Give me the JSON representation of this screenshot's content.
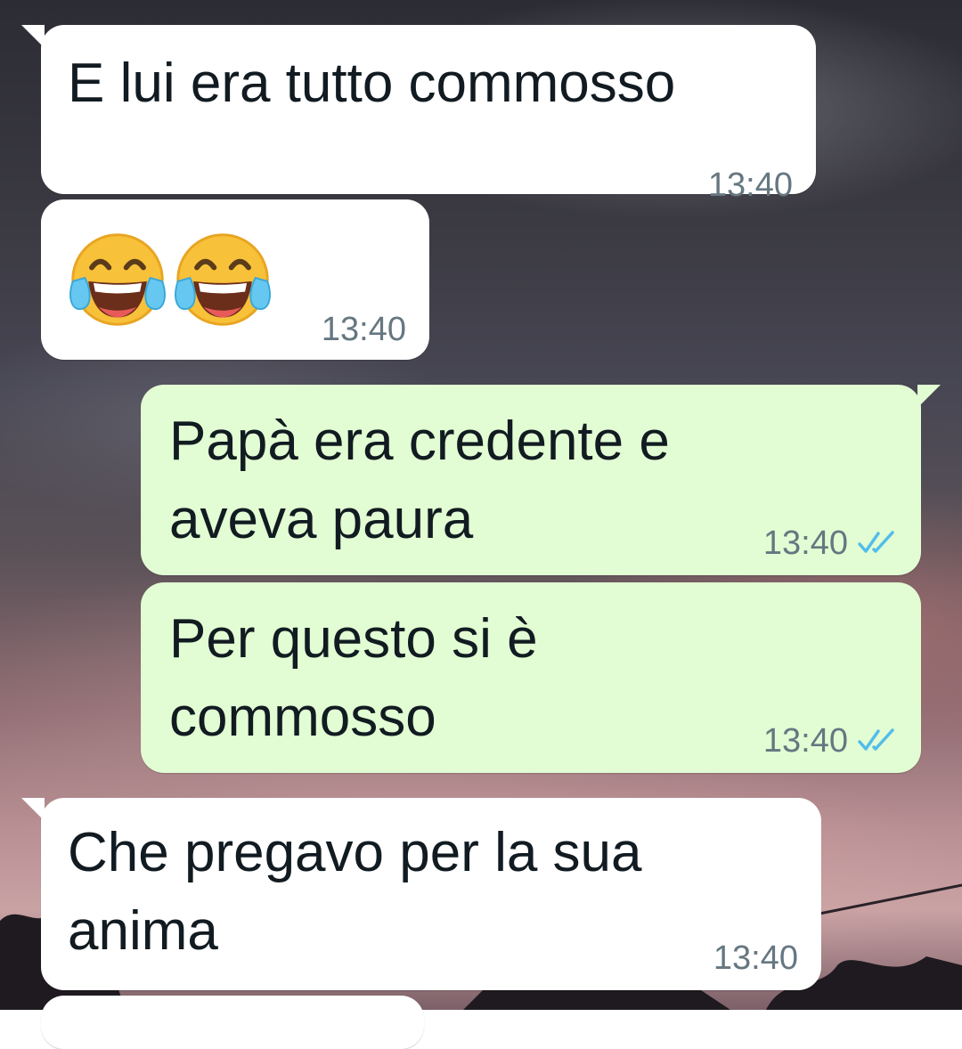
{
  "colors": {
    "incoming_bubble": "#ffffff",
    "outgoing_bubble": "#e2fdd3",
    "text": "#111b21",
    "timestamp": "#667781",
    "read_ticks": "#53bdeb"
  },
  "messages": [
    {
      "direction": "incoming",
      "lines": [
        "E lui era tutto commosso"
      ],
      "time": "13:40"
    },
    {
      "direction": "incoming",
      "emoji": [
        "face-with-tears-of-joy-icon",
        "face-with-tears-of-joy-icon"
      ],
      "time": "13:40"
    },
    {
      "direction": "outgoing",
      "lines": [
        "Papà era credente e",
        "aveva paura"
      ],
      "time": "13:40",
      "status": "read"
    },
    {
      "direction": "outgoing",
      "lines": [
        "Per questo si è",
        "commosso"
      ],
      "time": "13:40",
      "status": "read"
    },
    {
      "direction": "incoming",
      "lines": [
        "Che pregavo per la sua",
        "anima"
      ],
      "time": "13:40"
    }
  ]
}
